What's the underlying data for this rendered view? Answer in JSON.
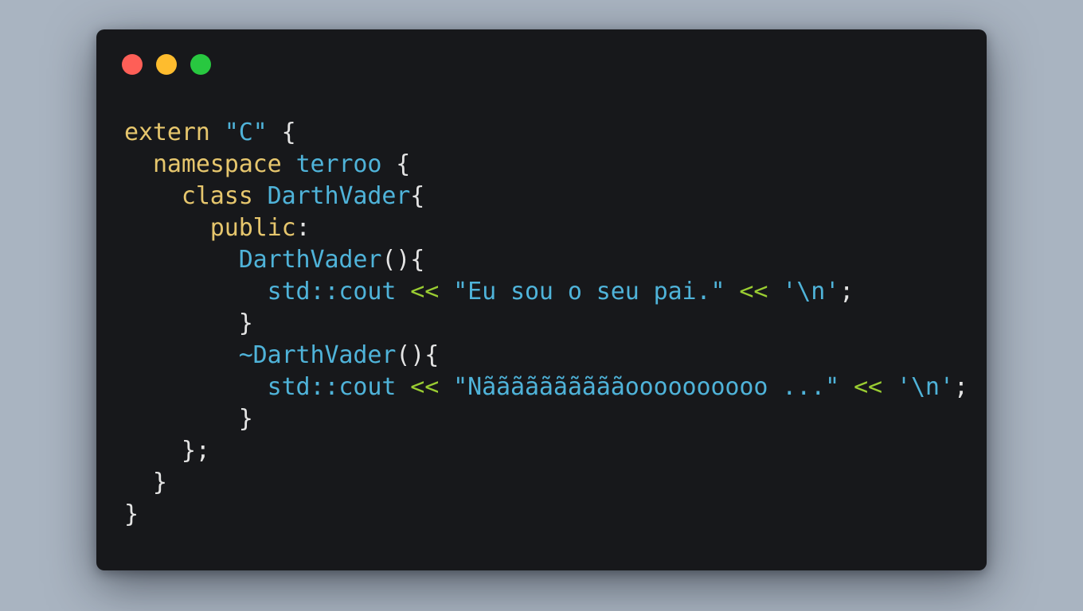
{
  "window": {
    "controls": [
      {
        "name": "close",
        "color": "#fe5f57"
      },
      {
        "name": "minimize",
        "color": "#febc2e"
      },
      {
        "name": "maximize",
        "color": "#28c840"
      }
    ]
  },
  "colors": {
    "background": "#a9b4c1",
    "editor_bg": "#17181b",
    "keyword": "#e6c66d",
    "type": "#4fb3d9",
    "string": "#4fb3d9",
    "operator": "#9acd32",
    "punctuation": "#e4e4e4"
  },
  "code": {
    "lines": [
      {
        "tokens": [
          {
            "t": "extern",
            "k": "kw"
          },
          {
            "t": " ",
            "k": "pn"
          },
          {
            "t": "\"C\"",
            "k": "str"
          },
          {
            "t": " {",
            "k": "pn"
          }
        ]
      },
      {
        "tokens": [
          {
            "t": "  ",
            "k": "pn"
          },
          {
            "t": "namespace",
            "k": "kw"
          },
          {
            "t": " ",
            "k": "pn"
          },
          {
            "t": "terroo",
            "k": "ty"
          },
          {
            "t": " {",
            "k": "pn"
          }
        ]
      },
      {
        "tokens": [
          {
            "t": "    ",
            "k": "pn"
          },
          {
            "t": "class",
            "k": "kw"
          },
          {
            "t": " ",
            "k": "pn"
          },
          {
            "t": "DarthVader",
            "k": "ty"
          },
          {
            "t": "{",
            "k": "pn"
          }
        ]
      },
      {
        "tokens": [
          {
            "t": "      ",
            "k": "pn"
          },
          {
            "t": "public",
            "k": "kw"
          },
          {
            "t": ":",
            "k": "pn"
          }
        ]
      },
      {
        "tokens": [
          {
            "t": "        ",
            "k": "pn"
          },
          {
            "t": "DarthVader",
            "k": "ty"
          },
          {
            "t": "(){",
            "k": "pn"
          }
        ]
      },
      {
        "tokens": [
          {
            "t": "          ",
            "k": "pn"
          },
          {
            "t": "std::cout",
            "k": "ty"
          },
          {
            "t": " ",
            "k": "pn"
          },
          {
            "t": "<<",
            "k": "op"
          },
          {
            "t": " ",
            "k": "pn"
          },
          {
            "t": "\"Eu sou o seu pai.\"",
            "k": "str"
          },
          {
            "t": " ",
            "k": "pn"
          },
          {
            "t": "<<",
            "k": "op"
          },
          {
            "t": " ",
            "k": "pn"
          },
          {
            "t": "'\\n'",
            "k": "str"
          },
          {
            "t": ";",
            "k": "pn"
          }
        ]
      },
      {
        "tokens": [
          {
            "t": "        }",
            "k": "pn"
          }
        ]
      },
      {
        "tokens": [
          {
            "t": "        ",
            "k": "pn"
          },
          {
            "t": "~DarthVader",
            "k": "ty"
          },
          {
            "t": "(){",
            "k": "pn"
          }
        ]
      },
      {
        "tokens": [
          {
            "t": "          ",
            "k": "pn"
          },
          {
            "t": "std::cout",
            "k": "ty"
          },
          {
            "t": " ",
            "k": "pn"
          },
          {
            "t": "<<",
            "k": "op"
          },
          {
            "t": " ",
            "k": "pn"
          },
          {
            "t": "\"Nããããããããããoooooooooo ...\"",
            "k": "str"
          },
          {
            "t": " ",
            "k": "pn"
          },
          {
            "t": "<<",
            "k": "op"
          },
          {
            "t": " ",
            "k": "pn"
          },
          {
            "t": "'\\n'",
            "k": "str"
          },
          {
            "t": ";",
            "k": "pn"
          }
        ]
      },
      {
        "tokens": [
          {
            "t": "        }",
            "k": "pn"
          }
        ]
      },
      {
        "tokens": [
          {
            "t": "    };",
            "k": "pn"
          }
        ]
      },
      {
        "tokens": [
          {
            "t": "  }",
            "k": "pn"
          }
        ]
      },
      {
        "tokens": [
          {
            "t": "}",
            "k": "pn"
          }
        ]
      }
    ]
  }
}
